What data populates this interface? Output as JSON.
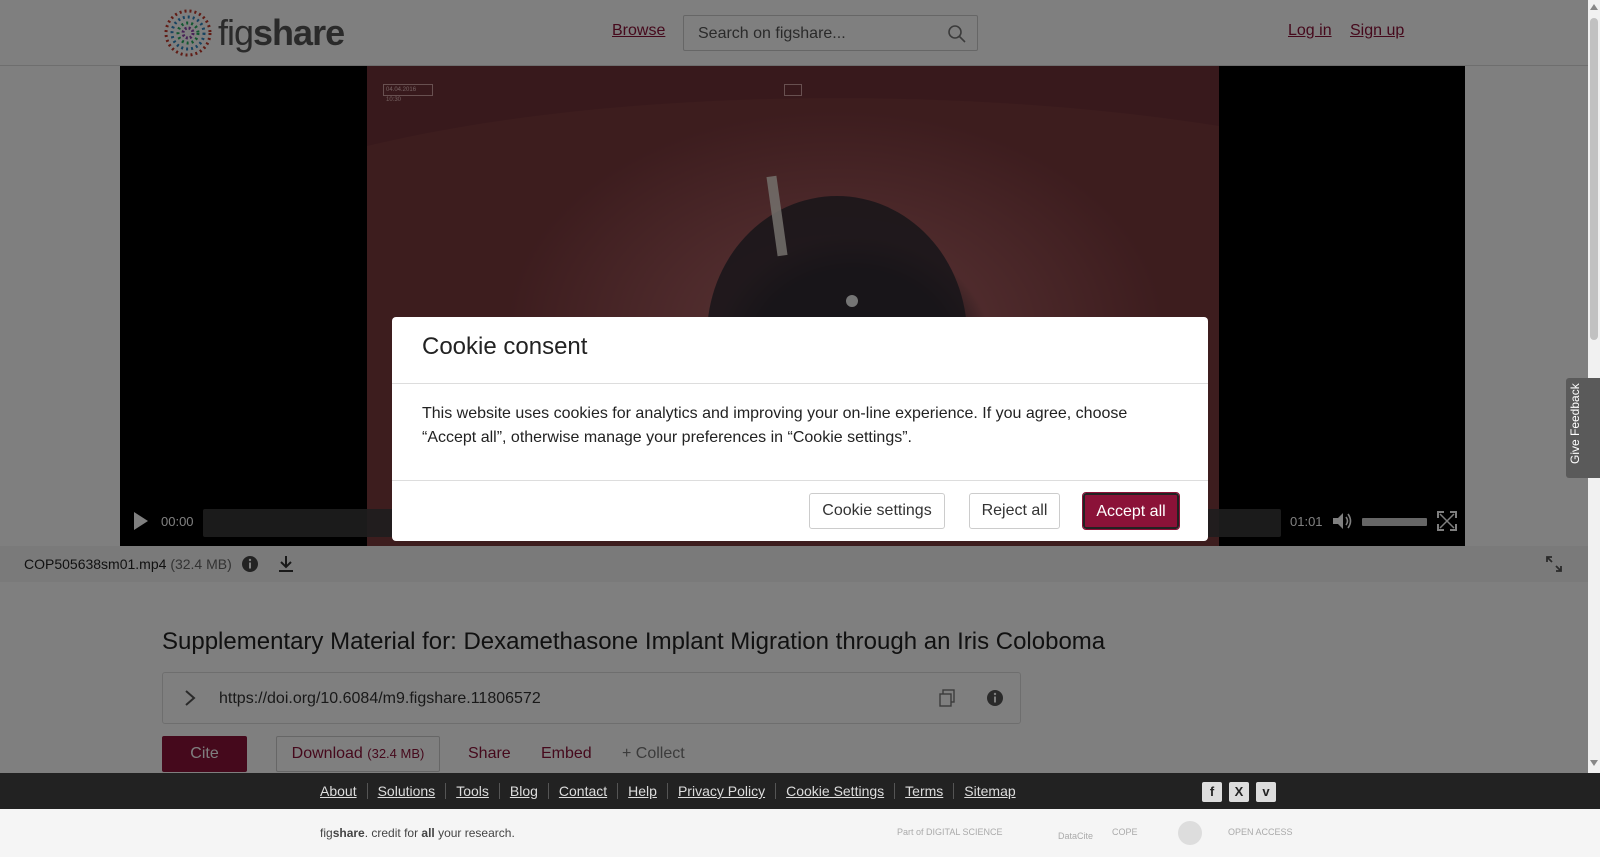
{
  "header": {
    "logo_text_light": "fig",
    "logo_text_bold": "share",
    "browse_label": "Browse",
    "search_placeholder": "Search on figshare...",
    "login_label": "Log in",
    "signup_label": "Sign up"
  },
  "video": {
    "current_time": "00:00",
    "total_time": "01:01",
    "progress": 0,
    "frame_stamp": "04.04.2016 10:30"
  },
  "file": {
    "name": "COP505638sm01.mp4",
    "size": "(32.4 MB)"
  },
  "article": {
    "title": "Supplementary Material for: Dexamethasone Implant Migration through an Iris Coloboma",
    "doi": "https://doi.org/10.6084/m9.figshare.11806572",
    "cite_label": "Cite",
    "download_label": "Download",
    "download_size": "(32.4 MB)",
    "share_label": "Share",
    "embed_label": "Embed",
    "collect_label": "+ Collect"
  },
  "cookie": {
    "title": "Cookie consent",
    "body": "This website uses cookies for analytics and improving your on-line experience. If you agree, choose “Accept all”, otherwise manage your preferences in “Cookie settings”.",
    "settings_label": "Cookie settings",
    "reject_label": "Reject all",
    "accept_label": "Accept all"
  },
  "feedback_label": "Give Feedback",
  "footer": {
    "links": [
      "About",
      "Solutions",
      "Tools",
      "Blog",
      "Contact",
      "Help",
      "Privacy Policy",
      "Cookie Settings",
      "Terms",
      "Sitemap"
    ],
    "tagline_fig": "fig",
    "tagline_share": "share",
    "tagline_mid": ". credit for ",
    "tagline_all": "all",
    "tagline_end": " your research.",
    "partners": [
      "Part of DIGITAL SCIENCE",
      "DataCite",
      "COPE",
      "",
      "OPEN ACCESS"
    ]
  },
  "colors": {
    "brand": "#8b1238"
  }
}
